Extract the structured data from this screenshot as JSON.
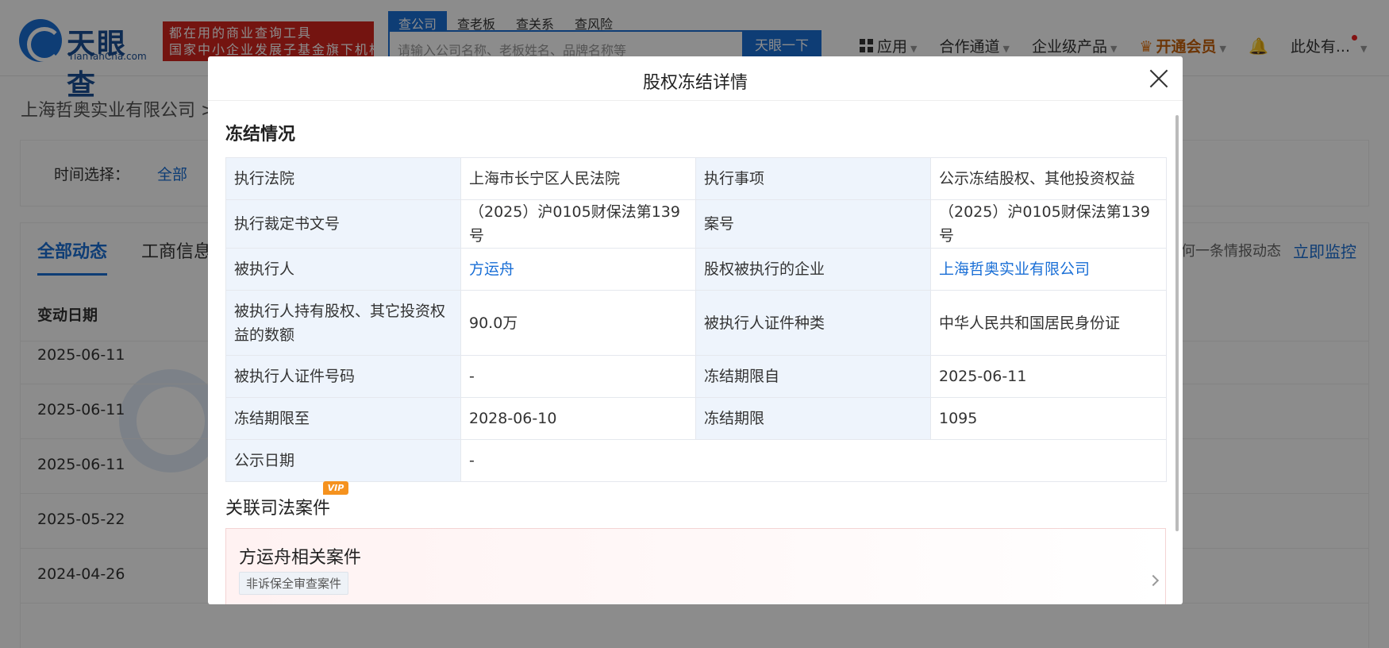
{
  "header": {
    "logo_text": "天眼查",
    "logo_sub": "TianYanCha.com",
    "slogan_line1": "都在用的商业查询工具",
    "slogan_line2": "国家中小企业发展子基金旗下机构",
    "search_tabs": [
      "查公司",
      "查老板",
      "查关系",
      "查风险"
    ],
    "search_placeholder": "请输入公司名称、老板姓名、品牌名称等",
    "search_button": "天眼一下",
    "nav": {
      "apps": "应用",
      "channel": "合作通道",
      "enterprise": "企业级产品",
      "vip": "开通会员",
      "user": "此处有..."
    }
  },
  "page": {
    "breadcrumb": "上海哲奥实业有限公司 >",
    "filter_label": "时间选择：",
    "filter_all": "全部",
    "tab_all": "全部动态",
    "tab_business": "工商信息",
    "monitor_text": "何一条情报动态",
    "monitor_link": "立即监控",
    "column_date": "变动日期",
    "dates": [
      "2025-06-11",
      "2025-06-11",
      "2025-06-11",
      "2025-05-22",
      "2024-04-26"
    ]
  },
  "modal": {
    "title": "股权冻结详情",
    "section_title": "冻结情况",
    "rows": [
      {
        "k1": "执行法院",
        "v1": "上海市长宁区人民法院",
        "k2": "执行事项",
        "v2": "公示冻结股权、其他投资权益"
      },
      {
        "k1": "执行裁定书文号",
        "v1": "（2025）沪0105财保法第139号",
        "k2": "案号",
        "v2": "（2025）沪0105财保法第139号"
      },
      {
        "k1": "被执行人",
        "v1": "方运舟",
        "k2": "股权被执行的企业",
        "v2": "上海哲奥实业有限公司"
      },
      {
        "k1": "被执行人持有股权、其它投资权益的数额",
        "v1": "90.0万",
        "k2": "被执行人证件种类",
        "v2": "中华人民共和国居民身份证"
      },
      {
        "k1": "被执行人证件号码",
        "v1": "-",
        "k2": "冻结期限自",
        "v2": "2025-06-11"
      },
      {
        "k1": "冻结期限至",
        "v1": "2028-06-10",
        "k2": "冻结期限",
        "v2": "1095"
      },
      {
        "k1": "公示日期",
        "v1": "-"
      }
    ],
    "related_title": "关联司法案件",
    "vip_badge": "VIP",
    "case_card": {
      "title": "方运舟相关案件",
      "tag": "非诉保全审查案件"
    }
  },
  "colors": {
    "brand_blue": "#1a6fd6",
    "slogan_red": "#d4251e",
    "vip_orange": "#f5921e",
    "key_cell_bg": "#eef4fc"
  }
}
